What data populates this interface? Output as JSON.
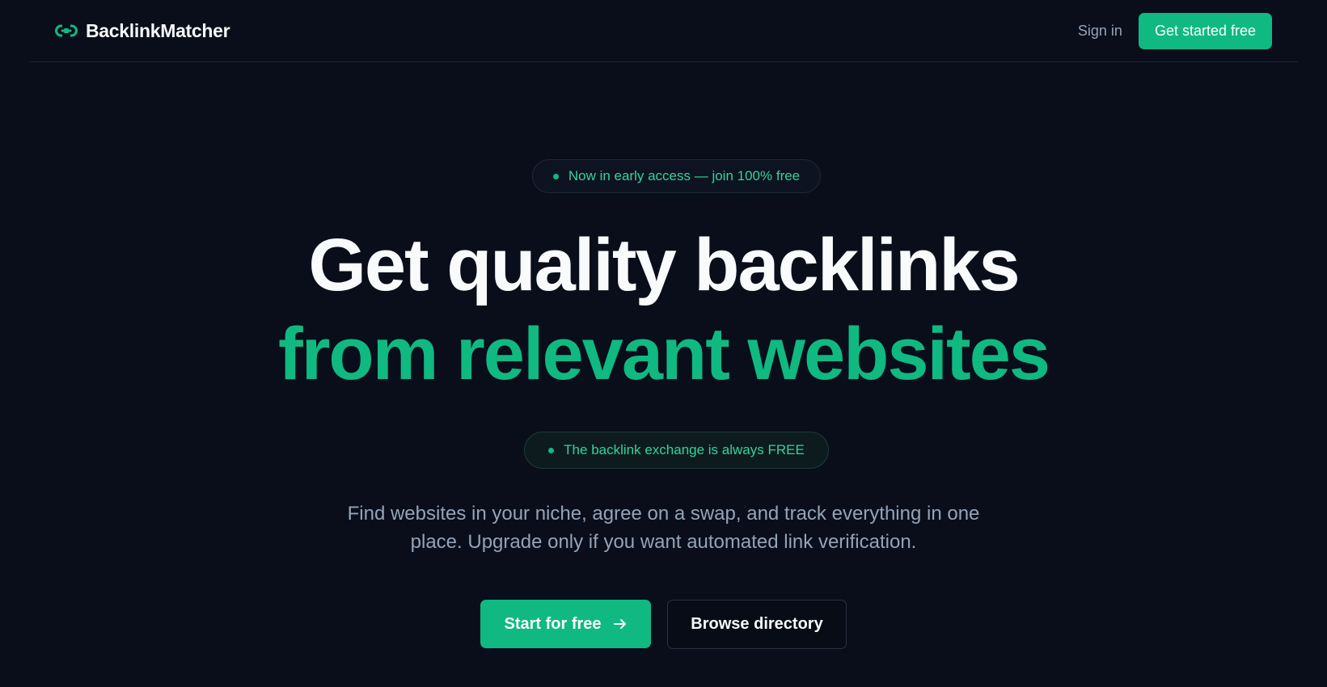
{
  "brand": {
    "name": "BacklinkMatcher",
    "icon": "link-icon"
  },
  "nav": {
    "signin_label": "Sign in",
    "cta_label": "Get started free"
  },
  "hero": {
    "badge_top": "Now in early access — join 100% free",
    "headline_line1": "Get quality backlinks",
    "headline_line2": "from relevant websites",
    "badge_free": "The backlink exchange is always FREE",
    "subtitle": "Find websites in your niche, agree on a swap, and track everything in one place. Upgrade only if you want automated link verification.",
    "primary_cta": "Start for free",
    "secondary_cta": "Browse directory"
  },
  "colors": {
    "background": "#090e1a",
    "accent": "#10b981",
    "text_primary": "#f8fafc",
    "text_muted": "#94a3b8"
  }
}
